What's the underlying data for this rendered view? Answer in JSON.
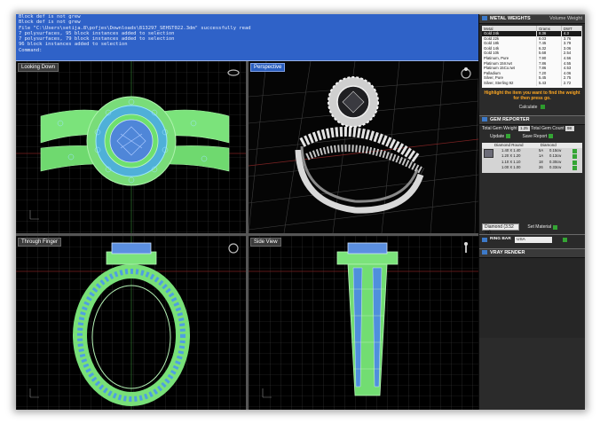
{
  "command_log": {
    "lines": [
      "Block def is not grew",
      "Block def is not grew",
      "File \"C:\\Users\\setija.8\\pofjes\\Downloads\\813297_SEHST022.3dm\" successfully read",
      "7 polysurfaces, 95 block instances added to selection",
      "7 polysurfaces, 79 block instances added to selection",
      "96 block instances added to selection",
      "Command:"
    ]
  },
  "viewports": {
    "top": {
      "label": "Looking Down"
    },
    "perspective": {
      "label": "Perspective"
    },
    "front": {
      "label": "Through Finger"
    },
    "right": {
      "label": "Side View"
    }
  },
  "sidebar": {
    "metal_weights": {
      "title": "METAL WEIGHTS",
      "subtitle": "Volume Weight",
      "columns": [
        "Metal",
        "Grams",
        "DWT"
      ],
      "rows": [
        [
          "Gold 24k",
          "8.36",
          "4.3"
        ],
        [
          "Gold 22k",
          "8.03",
          "3.76"
        ],
        [
          "Gold 18k",
          "7.45",
          "3.79"
        ],
        [
          "Gold 14k",
          "6.32",
          "3.06"
        ],
        [
          "Gold 10k",
          "5.68",
          "2.54"
        ],
        [
          "Platinum, Pure",
          "7.90",
          "4.56"
        ],
        [
          "Platinum 15Ir.Iwt",
          "7.86",
          "4.55"
        ],
        [
          "Platinum 15Co.Iwt",
          "7.86",
          "4.53"
        ],
        [
          "Palladium",
          "7.20",
          "4.06"
        ],
        [
          "Silver, Pure",
          "5.45",
          "2.75"
        ],
        [
          "Silver, Sterling 92",
          "5.43",
          "2.72"
        ]
      ],
      "hint": "Highlight the item you want to find the weight for then press go.",
      "calculate_label": "Calculate"
    },
    "gem_reporter": {
      "title": "GEM REPORTER",
      "total_weight_label": "Total Gem Weight",
      "total_weight_value": "1.25",
      "total_count_label": "Total Gem Count",
      "total_count_value": "98",
      "update_label": "Update",
      "save_report_label": "Save Report",
      "header_left": "Diamond Round",
      "header_right": "Diamond",
      "gems": [
        {
          "size": "1.40 X 1.40",
          "count": "5A",
          "weight": "0.15cw"
        },
        {
          "size": "1.20 X 1.20",
          "count": "1A",
          "weight": "0.13cw"
        },
        {
          "size": "1.10 X 1.10",
          "count": "18",
          "weight": "0.30cw"
        },
        {
          "size": "1.00 X 1.00",
          "count": "26",
          "weight": "0.33cw"
        }
      ],
      "material_value": "Diamond  (3.52 sg)",
      "set_material_label": "Set Material"
    },
    "ring_bar": {
      "label": "RING BAR",
      "value": "USA"
    },
    "vray": {
      "title": "VRAY RENDER"
    }
  }
}
